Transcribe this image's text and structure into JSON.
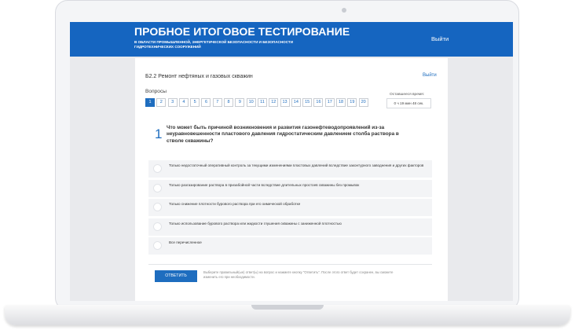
{
  "header": {
    "title": "ПРОБНОЕ ИТОГОВОЕ ТЕСТИРОВАНИЕ",
    "subtitle_line1": "В ОБЛАСТИ ПРОМЫШЛЕННОЙ, ЭНЕРГЕТИЧЕСКОЙ БЕЗОПАСНОСТИ И БЕЗОПАСНОСТИ",
    "subtitle_line2": "ГИДРОТЕХНИЧЕСКИХ СООРУЖЕНИЙ",
    "logout": "Выйти"
  },
  "card": {
    "ticket_title": "Б2.2 Ремонт нефтяных и газовых скважин",
    "logout": "Выйти",
    "questions_label": "Вопросы",
    "question_numbers": [
      "1",
      "2",
      "3",
      "4",
      "5",
      "6",
      "7",
      "8",
      "9",
      "10",
      "11",
      "12",
      "13",
      "14",
      "15",
      "16",
      "17",
      "18",
      "19",
      "20"
    ],
    "active_question": "1",
    "timer_label": "Оставшееся время:",
    "timer_value": "0 ч 19 мин 48 сек."
  },
  "question": {
    "number": "1",
    "text": "Что может быть причиной возникновения и развития газонефтеводопроявлений из-за неуравновешенности пластового давления гидростатическим давлением столба раствора в стволе скважины?",
    "answers": [
      "Только недостаточный оперативный контроль за текущими изменениями пластовых давлений вследствие законтурного заводнения и других факторов",
      "Только разгазирование раствора в призабойной части вследствие длительных простоев скважины без промывок",
      "Только снижение плотности бурового раствора при его химической обработке",
      "Только использование бурового раствора или жидкости глушения скважины с заниженной плотностью",
      "Все перечисленное"
    ]
  },
  "footer": {
    "submit_label": "ОТВЕТИТЬ",
    "hint": "Выберите правильный(ые) ответ(ы) на вопрос и нажмите кнопку \"Ответить\". После этого ответ будет сохранен, вы сможете изменить его при необходимости."
  },
  "colors": {
    "header_blue": "#1565c0",
    "accent_blue": "#1e6dbf"
  }
}
